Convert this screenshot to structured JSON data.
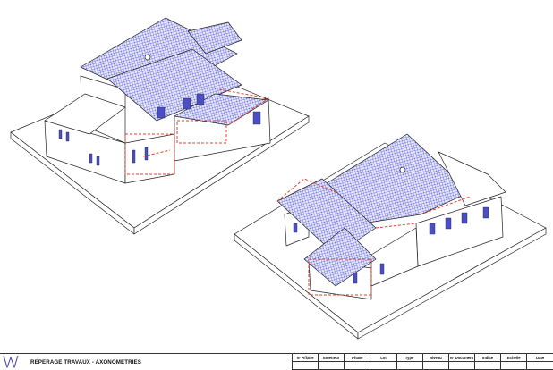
{
  "title_block": {
    "document_title": "REPERAGE TRAVAUX - AXONOMETRIES",
    "columns": [
      "N° Affaire",
      "Emetteur",
      "Phase",
      "Lot",
      "Type",
      "Niveau",
      "N° Document",
      "Indice",
      "Echelle",
      "Date"
    ]
  },
  "colors": {
    "roof_hatch": "#5a5fd6",
    "roof_fill": "#e4e5fb",
    "works_marker": "#e0412c",
    "line": "#222222",
    "windows": "#4a4fc8"
  },
  "icons": {
    "logo": "firm-logo"
  }
}
